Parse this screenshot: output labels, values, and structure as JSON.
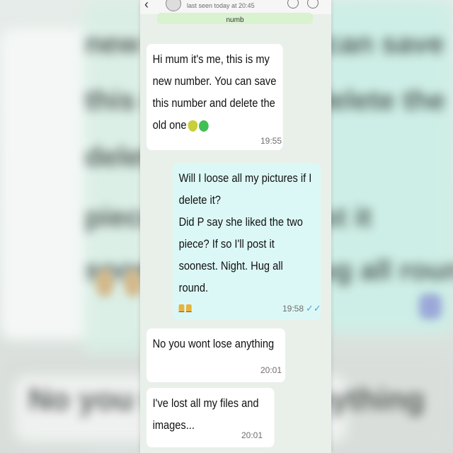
{
  "header": {
    "last_seen": "last seen today at 20:45"
  },
  "banner": {
    "text": "numb"
  },
  "messages": [
    {
      "direction": "incoming",
      "text": "Hi mum it's me, this is my\nnew number. You can save\nthis number and delete the\nold one",
      "emojis": [
        "green-heart-icon",
        "sick-face-icon"
      ],
      "time": "19:55"
    },
    {
      "direction": "outgoing",
      "text": "Will I loose all my pictures if I\ndelete it?\nDid P say she liked the two\npiece? If so I'll post it\nsoonest. Night. Hug all round.",
      "emojis": [
        "wine-glass-icon",
        "wine-glass-icon"
      ],
      "time": "19:58",
      "status": "read"
    },
    {
      "direction": "incoming",
      "text": "No you wont lose anything",
      "time": "20:01"
    },
    {
      "direction": "incoming",
      "text": "I've lost all my files and\nimages...",
      "time": "20:01"
    }
  ],
  "background_text": {
    "rows": [
      "new number. You can save",
      "this number and delete the",
      "delete it?",
      "piece? If so I'll post it",
      "soonest. Night. Hug all round",
      "No you wont lose anything"
    ]
  },
  "colors": {
    "incoming_bubble": "#ffffff",
    "outgoing_bubble": "#dcf8f6",
    "chat_background": "#e9efe9",
    "read_check": "#4aa3df"
  }
}
